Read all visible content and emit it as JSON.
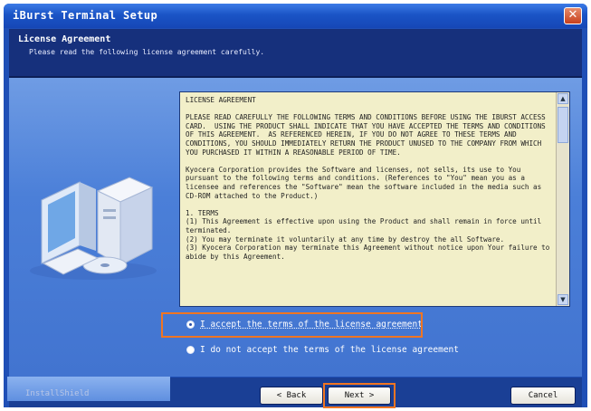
{
  "window": {
    "title": "iBurst Terminal Setup",
    "close_glyph": "✕"
  },
  "header": {
    "title": "License Agreement",
    "description": "Please read the following license agreement carefully."
  },
  "license": {
    "text": "LICENSE AGREEMENT\n\nPLEASE READ CAREFULLY THE FOLLOWING TERMS AND CONDITIONS BEFORE USING THE IBURST ACCESS CARD.  USING THE PRODUCT SHALL INDICATE THAT YOU HAVE ACCEPTED THE TERMS AND CONDITIONS OF THIS AGREEMENT.  AS REFERENCED HEREIN, IF YOU DO NOT AGREE TO THESE TERMS AND CONDITIONS, YOU SHOULD IMMEDIATELY RETURN THE PRODUCT UNUSED TO THE COMPANY FROM WHICH YOU PURCHASED IT WITHIN A REASONABLE PERIOD OF TIME.\n\nKyocera Corporation provides the Software and licenses, not sells, its use to You pursuant to the following terms and conditions. (References to \"You\" mean you as a licensee and references the \"Software\" mean the software included in the media such as CD-ROM attached to the Product.)\n\n1. TERMS\n(1) This Agreement is effective upon using the Product and shall remain in force until terminated.\n(2) You may terminate it voluntarily at any time by destroy the all Software.\n(3) Kyocera Corporation may terminate this Agreement without notice upon Your failure to abide by this Agreement."
  },
  "options": {
    "accept_label": "I accept the terms of the license agreement",
    "decline_label": "I do not accept the terms of the license agreement",
    "selected": "accept"
  },
  "footer": {
    "brand": "InstallShield",
    "back_label": "< Back",
    "next_label": "Next >",
    "cancel_label": "Cancel"
  },
  "colors": {
    "highlight": "#f07522",
    "window_blue": "#1f4fb6",
    "license_bg": "#f2efc9"
  },
  "icons": {
    "illustration": "computer-with-cd-icon",
    "close": "close-icon",
    "scroll_up": "scroll-up-icon",
    "scroll_down": "scroll-down-icon"
  }
}
